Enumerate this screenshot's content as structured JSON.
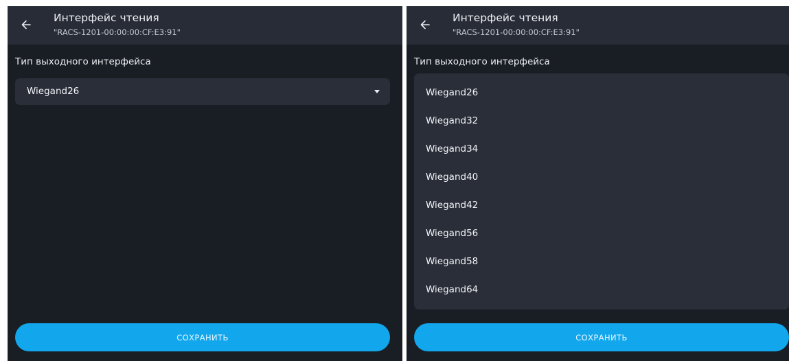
{
  "header": {
    "title": "Интерфейс чтения",
    "subtitle": "\"RACS-1201-00:00:00:CF:E3:91\""
  },
  "field": {
    "label": "Тип выходного интерфейса",
    "selected": "Wiegand26",
    "options": [
      "Wiegand26",
      "Wiegand32",
      "Wiegand34",
      "Wiegand40",
      "Wiegand42",
      "Wiegand56",
      "Wiegand58",
      "Wiegand64"
    ]
  },
  "save_button": {
    "label": "СОХРАНИТЬ"
  },
  "colors": {
    "background": "#191d24",
    "appbar": "#272c36",
    "surface": "#292e38",
    "accent": "#12a7ec"
  },
  "icons": [
    "arrow-left-icon",
    "caret-down-icon"
  ]
}
